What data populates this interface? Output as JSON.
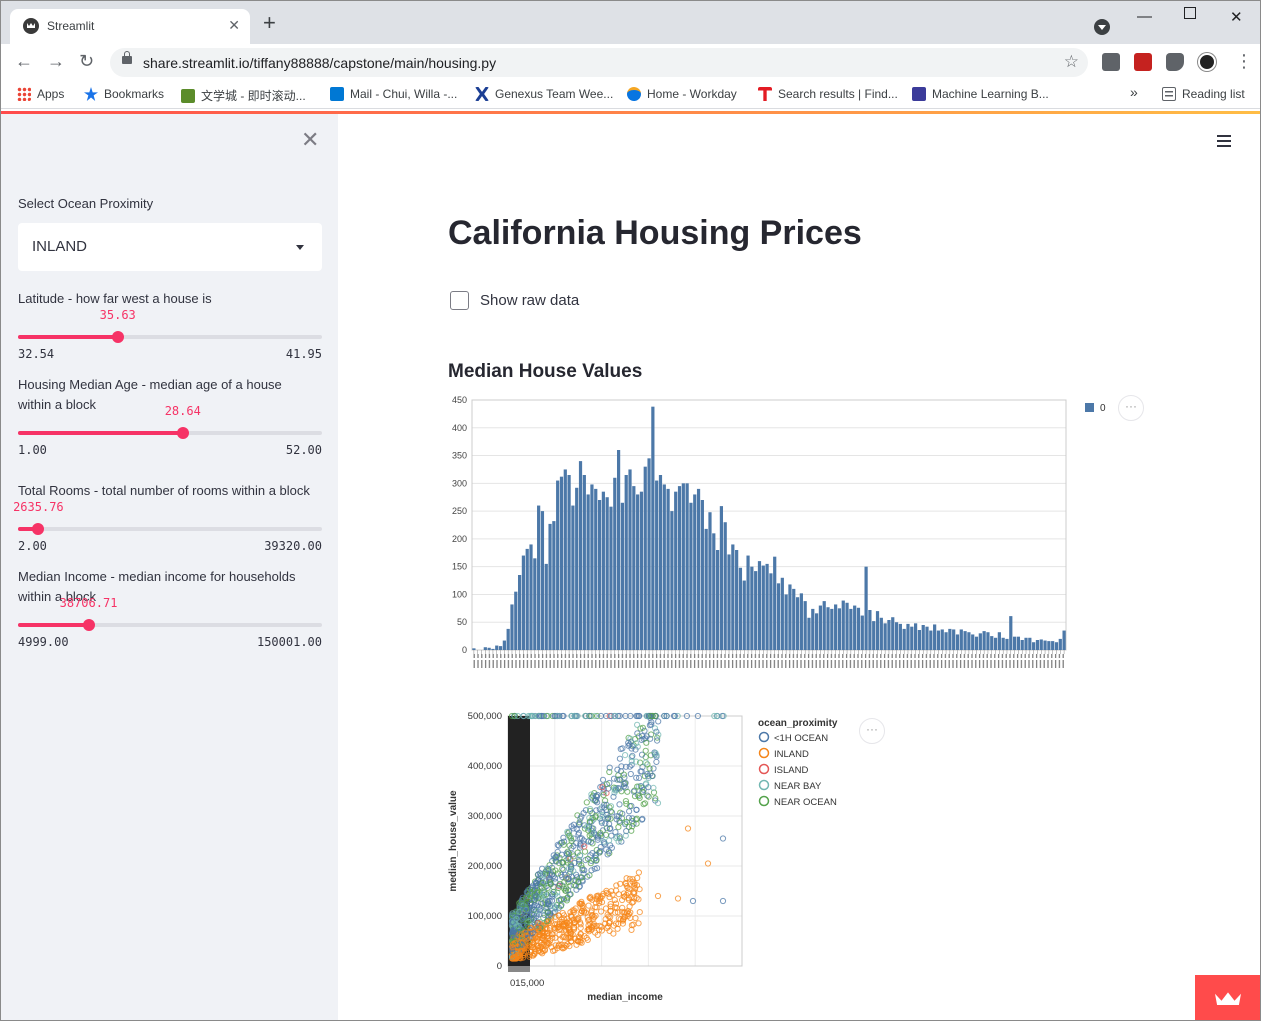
{
  "browser": {
    "tab_title": "Streamlit",
    "url": "share.streamlit.io/tiffany88888/capstone/main/housing.py",
    "bookmarks": [
      {
        "label": "Apps",
        "color": "#ea4335"
      },
      {
        "label": "Bookmarks",
        "color": "#1a73e8"
      },
      {
        "label": "文学城 - 即时滚动...",
        "color": "#5b8c2a"
      },
      {
        "label": "Mail - Chui, Willa -...",
        "color": "#0078d4"
      },
      {
        "label": "Genexus Team Wee...",
        "color": "#1c3f94"
      },
      {
        "label": "Home - Workday",
        "color": "#f5a623"
      },
      {
        "label": "Search results | Find...",
        "color": "#e31b23"
      },
      {
        "label": "Machine Learning B...",
        "color": "#3b3b9a"
      }
    ],
    "overflow": "»",
    "reading_list": "Reading list"
  },
  "sidebar": {
    "select_label": "Select Ocean Proximity",
    "select_value": "INLAND",
    "sliders": [
      {
        "label": "Latitude - how far west a house is",
        "value": "35.63",
        "min": "32.54",
        "max": "41.95",
        "frac": 0.328
      },
      {
        "label": "Housing Median Age - median age of a house within a block",
        "value": "28.64",
        "min": "1.00",
        "max": "52.00",
        "frac": 0.542
      },
      {
        "label": "Total Rooms - total number of rooms within a block",
        "value": "2635.76",
        "min": "2.00",
        "max": "39320.00",
        "frac": 0.067
      },
      {
        "label": "Median Income - median income for households within a block",
        "value": "38706.71",
        "min": "4999.00",
        "max": "150001.00",
        "frac": 0.232
      }
    ]
  },
  "main": {
    "title": "California Housing Prices",
    "checkbox_label": "Show raw data",
    "subheader": "Median House Values"
  },
  "chart_data": [
    {
      "type": "bar",
      "title": "",
      "ylim": [
        0,
        450
      ],
      "yticks": [
        "0",
        "50",
        "100",
        "150",
        "200",
        "250",
        "300",
        "350",
        "400",
        "450"
      ],
      "legend": [
        "0"
      ],
      "legend_position": "top-right",
      "series_color": "#4c78a8",
      "values": [
        3,
        0,
        0,
        5,
        4,
        2,
        8,
        7,
        17,
        38,
        82,
        105,
        135,
        170,
        182,
        190,
        165,
        260,
        250,
        155,
        227,
        232,
        305,
        312,
        325,
        315,
        260,
        292,
        340,
        315,
        280,
        298,
        290,
        270,
        285,
        275,
        258,
        310,
        360,
        265,
        315,
        325,
        295,
        280,
        285,
        330,
        345,
        438,
        305,
        315,
        298,
        290,
        250,
        285,
        295,
        300,
        300,
        265,
        280,
        290,
        270,
        218,
        248,
        210,
        180,
        259,
        230,
        172,
        190,
        180,
        148,
        125,
        170,
        150,
        142,
        160,
        152,
        155,
        138,
        168,
        120,
        130,
        100,
        118,
        110,
        95,
        102,
        88,
        58,
        74,
        66,
        80,
        88,
        77,
        74,
        82,
        75,
        89,
        85,
        74,
        80,
        76,
        62,
        150,
        72,
        52,
        70,
        58,
        48,
        54,
        59,
        50,
        47,
        38,
        47,
        42,
        48,
        36,
        45,
        42,
        35,
        46,
        35,
        37,
        32,
        38,
        37,
        28,
        37,
        34,
        32,
        28,
        24,
        30,
        34,
        32,
        25,
        22,
        32,
        22,
        20,
        61,
        24,
        24,
        18,
        22,
        22,
        14,
        18,
        19,
        17,
        16,
        16,
        14,
        20,
        35
      ]
    },
    {
      "type": "scatter",
      "title": "",
      "xlabel": "median_income",
      "ylabel": "median_house_value",
      "x_tick_label": "015,000",
      "yticks": [
        "0",
        "100,000",
        "200,000",
        "300,000",
        "400,000",
        "500,000"
      ],
      "ylim": [
        0,
        500000
      ],
      "legend_title": "ocean_proximity",
      "legend_position": "right",
      "series": [
        {
          "name": "<1H OCEAN",
          "color": "#4c78a8"
        },
        {
          "name": "INLAND",
          "color": "#f58518"
        },
        {
          "name": "ISLAND",
          "color": "#e45756"
        },
        {
          "name": "NEAR BAY",
          "color": "#72b7b2"
        },
        {
          "name": "NEAR OCEAN",
          "color": "#54a24b"
        }
      ]
    }
  ],
  "ui": {
    "more_icon_glyph": "···",
    "close_glyph": "✕",
    "tab_close_glyph": "✕",
    "new_tab_glyph": "+"
  }
}
